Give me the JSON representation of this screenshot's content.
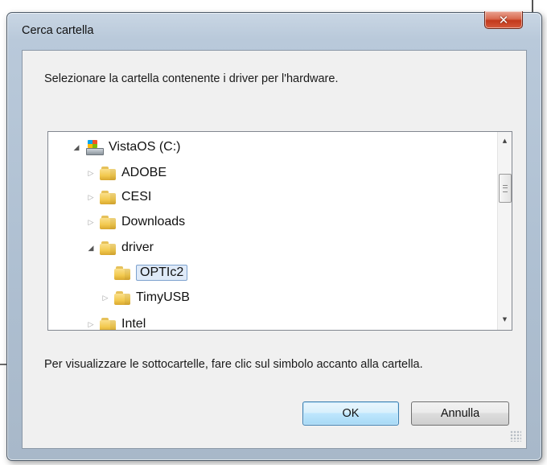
{
  "window": {
    "title": "Cerca cartella",
    "close_label": "✕"
  },
  "instruction": "Selezionare la cartella contenente i driver per l'hardware.",
  "tree": {
    "items": [
      {
        "label": "VistaOS (C:)",
        "icon": "drive-icon",
        "state": "expanded",
        "level": 0
      },
      {
        "label": "ADOBE",
        "icon": "folder-icon",
        "state": "collapsed",
        "level": 1
      },
      {
        "label": "CESI",
        "icon": "folder-icon",
        "state": "collapsed",
        "level": 1
      },
      {
        "label": "Downloads",
        "icon": "folder-icon",
        "state": "collapsed",
        "level": 1
      },
      {
        "label": "driver",
        "icon": "folder-icon",
        "state": "expanded",
        "level": 1
      },
      {
        "label": "OPTIc2",
        "icon": "folder-icon",
        "state": "leaf",
        "level": 2,
        "selected": true
      },
      {
        "label": "TimyUSB",
        "icon": "folder-icon",
        "state": "collapsed",
        "level": 2
      },
      {
        "label": "Intel",
        "icon": "folder-icon",
        "state": "collapsed",
        "level": 1
      }
    ]
  },
  "help_text": "Per visualizzare le sottocartelle, fare clic sul simbolo accanto alla cartella.",
  "buttons": {
    "ok": "OK",
    "cancel": "Annulla"
  },
  "colors": {
    "selection_fill": "#dfeaf8",
    "selection_border": "#7da2ce",
    "close_button": "#c3391c",
    "default_button": "#bee6fd"
  }
}
